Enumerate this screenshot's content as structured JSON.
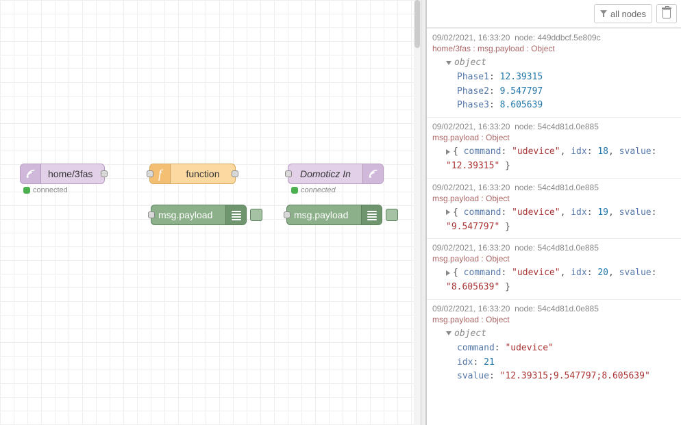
{
  "toolbar": {
    "filter_label": "all nodes"
  },
  "nodes": {
    "mqtt_in": {
      "label": "home/3fas",
      "status": "connected"
    },
    "func": {
      "label": "function"
    },
    "mqtt_out": {
      "label": "Domoticz In",
      "status": "connected"
    },
    "dbg1": {
      "label": "msg.payload"
    },
    "dbg2": {
      "label": "msg.payload"
    }
  },
  "messages": [
    {
      "time": "09/02/2021, 16:33:20",
      "node": "449ddbcf.5e809c",
      "topic": "home/3fas : msg.payload : Object",
      "mode": "expanded-object",
      "props": [
        {
          "key": "Phase1",
          "val": "12.39315",
          "type": "num"
        },
        {
          "key": "Phase2",
          "val": "9.547797",
          "type": "num"
        },
        {
          "key": "Phase3",
          "val": "8.605639",
          "type": "num"
        }
      ]
    },
    {
      "time": "09/02/2021, 16:33:20",
      "node": "54c4d81d.0e885",
      "topic": "msg.payload : Object",
      "mode": "collapsed",
      "collapsed": [
        {
          "t": "punc",
          "v": "{ "
        },
        {
          "t": "key",
          "v": "command"
        },
        {
          "t": "punc",
          "v": ": "
        },
        {
          "t": "str",
          "v": "\"udevice\""
        },
        {
          "t": "punc",
          "v": ", "
        },
        {
          "t": "key",
          "v": "idx"
        },
        {
          "t": "punc",
          "v": ": "
        },
        {
          "t": "num",
          "v": "18"
        },
        {
          "t": "punc",
          "v": ", "
        },
        {
          "t": "key",
          "v": "svalue"
        },
        {
          "t": "punc",
          "v": ": "
        },
        {
          "t": "str",
          "v": "\"12.39315\""
        },
        {
          "t": "punc",
          "v": " }"
        }
      ]
    },
    {
      "time": "09/02/2021, 16:33:20",
      "node": "54c4d81d.0e885",
      "topic": "msg.payload : Object",
      "mode": "collapsed",
      "collapsed": [
        {
          "t": "punc",
          "v": "{ "
        },
        {
          "t": "key",
          "v": "command"
        },
        {
          "t": "punc",
          "v": ": "
        },
        {
          "t": "str",
          "v": "\"udevice\""
        },
        {
          "t": "punc",
          "v": ", "
        },
        {
          "t": "key",
          "v": "idx"
        },
        {
          "t": "punc",
          "v": ": "
        },
        {
          "t": "num",
          "v": "19"
        },
        {
          "t": "punc",
          "v": ", "
        },
        {
          "t": "key",
          "v": "svalue"
        },
        {
          "t": "punc",
          "v": ": "
        },
        {
          "t": "str",
          "v": "\"9.547797\""
        },
        {
          "t": "punc",
          "v": " }"
        }
      ]
    },
    {
      "time": "09/02/2021, 16:33:20",
      "node": "54c4d81d.0e885",
      "topic": "msg.payload : Object",
      "mode": "collapsed",
      "collapsed": [
        {
          "t": "punc",
          "v": "{ "
        },
        {
          "t": "key",
          "v": "command"
        },
        {
          "t": "punc",
          "v": ": "
        },
        {
          "t": "str",
          "v": "\"udevice\""
        },
        {
          "t": "punc",
          "v": ", "
        },
        {
          "t": "key",
          "v": "idx"
        },
        {
          "t": "punc",
          "v": ": "
        },
        {
          "t": "num",
          "v": "20"
        },
        {
          "t": "punc",
          "v": ", "
        },
        {
          "t": "key",
          "v": "svalue"
        },
        {
          "t": "punc",
          "v": ": "
        },
        {
          "t": "str",
          "v": "\"8.605639\""
        },
        {
          "t": "punc",
          "v": " }"
        }
      ]
    },
    {
      "time": "09/02/2021, 16:33:20",
      "node": "54c4d81d.0e885",
      "topic": "msg.payload : Object",
      "mode": "expanded-object",
      "props": [
        {
          "key": "command",
          "val": "\"udevice\"",
          "type": "str"
        },
        {
          "key": "idx",
          "val": "21",
          "type": "num"
        },
        {
          "key": "svalue",
          "val": "\"12.39315;9.547797;8.605639\"",
          "type": "str"
        }
      ]
    }
  ],
  "labels": {
    "object": "object",
    "node_prefix": "node: "
  }
}
